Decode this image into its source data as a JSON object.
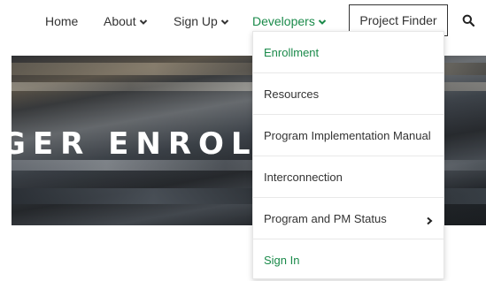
{
  "nav": {
    "items": [
      {
        "label": "Home",
        "has_chevron": false
      },
      {
        "label": "About",
        "has_chevron": true
      },
      {
        "label": "Sign Up",
        "has_chevron": true
      },
      {
        "label": "Developers",
        "has_chevron": true,
        "active": true
      }
    ],
    "project_finder_label": "Project Finder",
    "search_icon": "search-icon"
  },
  "hero": {
    "text": "GER ENROLL"
  },
  "dropdown": {
    "items": [
      {
        "label": "Enrollment",
        "highlighted": true
      },
      {
        "label": "Resources"
      },
      {
        "label": "Program Implementation Manual"
      },
      {
        "label": "Interconnection"
      },
      {
        "label": "Program and PM Status",
        "has_submenu": true
      },
      {
        "label": "Sign In",
        "highlighted": true
      }
    ]
  },
  "colors": {
    "accent_green": "#1a8a4a",
    "text": "#333333",
    "divider": "#e8e8e8"
  }
}
